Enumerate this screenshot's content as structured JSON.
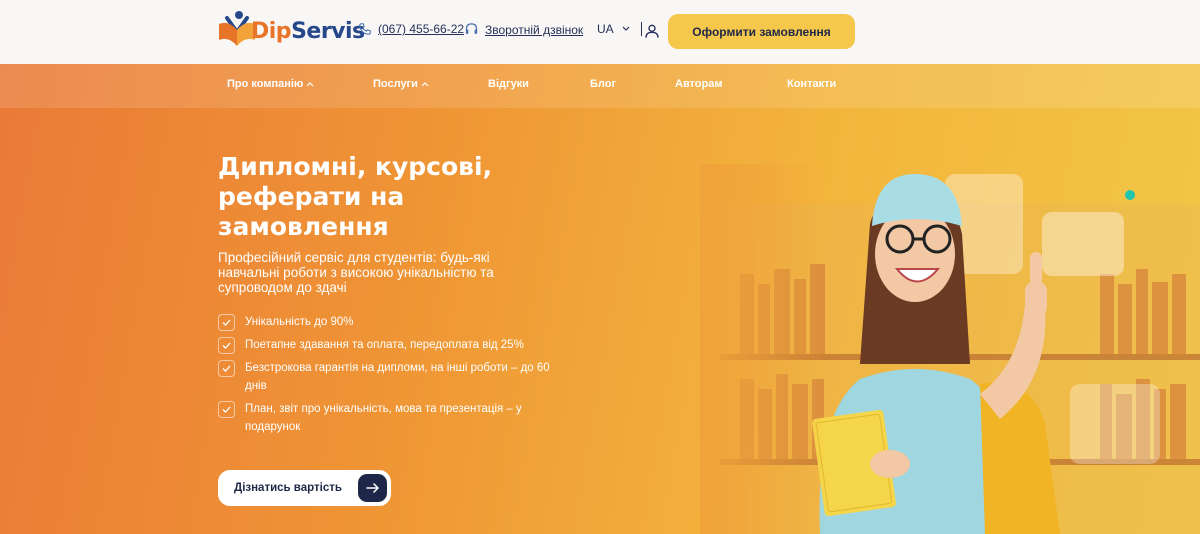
{
  "header": {
    "logo": {
      "part1": "Dip",
      "part2": "Servis"
    },
    "phone": "(067) 455-66-22",
    "callback": "Зворотній дзвінок",
    "language": "UA",
    "order_button": "Оформити замовлення"
  },
  "nav": {
    "items": [
      {
        "label": "Про компанію",
        "has_dropdown": true
      },
      {
        "label": "Послуги",
        "has_dropdown": true
      },
      {
        "label": "Відгуки",
        "has_dropdown": false
      },
      {
        "label": "Блог",
        "has_dropdown": false
      },
      {
        "label": "Авторам",
        "has_dropdown": false
      },
      {
        "label": "Контакти",
        "has_dropdown": false
      }
    ]
  },
  "hero": {
    "title": "Дипломні, курсові, реферати на замовлення",
    "subtitle": "Професійний сервіс для студентів: будь-які навчальні роботи з високою унікальністю та супроводом до здачі",
    "features": [
      "Унікальність до 90%",
      "Поетапне здавання та оплата, передоплата від 25%",
      "Безстрокова гарантія на дипломи, на інші роботи – до 60 днів",
      "План, звіт про унікальність, мова та презентація – у подарунок"
    ],
    "cta": "Дізнатись вартість"
  },
  "colors": {
    "accent_yellow": "#f5c84c",
    "navy": "#1f2748",
    "orange": "#ea7a37",
    "logo_blue": "#26478a"
  },
  "icons": [
    "phone-icon",
    "headset-icon",
    "chevron-down-icon",
    "user-icon",
    "check-icon",
    "arrow-right-icon"
  ]
}
